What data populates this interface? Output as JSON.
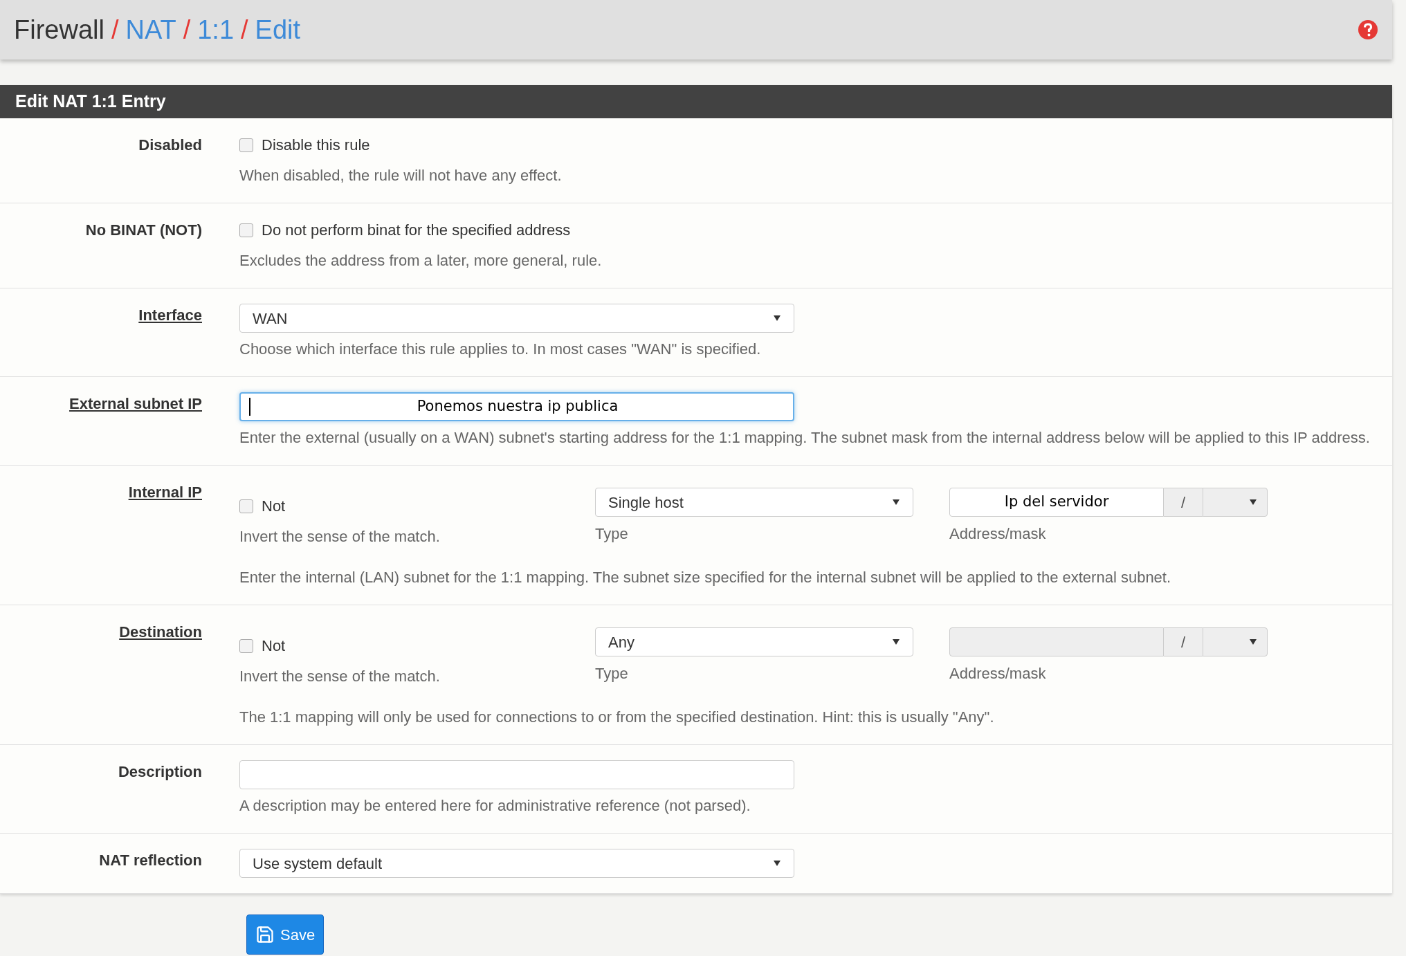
{
  "breadcrumb": [
    {
      "label": "Firewall",
      "link": false
    },
    {
      "label": "NAT",
      "link": true
    },
    {
      "label": "1:1",
      "link": true
    },
    {
      "label": "Edit",
      "link": true
    }
  ],
  "breadcrumb_separator": "/",
  "panel": {
    "title": "Edit NAT 1:1 Entry"
  },
  "rows": [
    {
      "kind": "checkbox",
      "label": "Disabled",
      "link": false,
      "checked": false,
      "option": "Disable this rule",
      "help": "When disabled, the rule will not have any effect."
    },
    {
      "kind": "checkbox",
      "label": "No BINAT (NOT)",
      "link": false,
      "checked": false,
      "option": "Do not perform binat for the specified address",
      "help": "Excludes the address from a later, more general, rule."
    },
    {
      "kind": "select",
      "label": "Interface",
      "link": true,
      "value": "WAN",
      "help": "Choose which interface this rule applies to. In most cases \"WAN\" is specified."
    },
    {
      "kind": "text",
      "label": "External subnet IP",
      "link": true,
      "focused": true,
      "value": "Ponemos nuestra ip publica",
      "help": "Enter the external (usually on a WAN) subnet's starting address for the 1:1 mapping. The subnet mask from the internal address below will be applied to this IP address."
    },
    {
      "kind": "address",
      "label": "Internal IP",
      "link": true,
      "checked": false,
      "option": "Not",
      "option_help": "Invert the sense of the match.",
      "type_value": "Single host",
      "type_label": "Type",
      "address_value": "Ip del servidor",
      "address_disabled": false,
      "slash": "/",
      "address_label": "Address/mask",
      "help": "Enter the internal (LAN) subnet for the 1:1 mapping. The subnet size specified for the internal subnet will be applied to the external subnet."
    },
    {
      "kind": "address",
      "label": "Destination",
      "link": true,
      "checked": false,
      "option": "Not",
      "option_help": "Invert the sense of the match.",
      "type_value": "Any",
      "type_label": "Type",
      "address_disabled": true,
      "slash": "/",
      "address_label": "Address/mask",
      "help": "The 1:1 mapping will only be used for connections to or from the specified destination. Hint: this is usually \"Any\"."
    },
    {
      "kind": "text",
      "label": "Description",
      "link": false,
      "focused": false,
      "help": "A description may be entered here for administrative reference (not parsed)."
    },
    {
      "kind": "select",
      "label": "NAT reflection",
      "link": false,
      "value": "Use system default"
    }
  ],
  "save_button": {
    "label": "Save"
  }
}
